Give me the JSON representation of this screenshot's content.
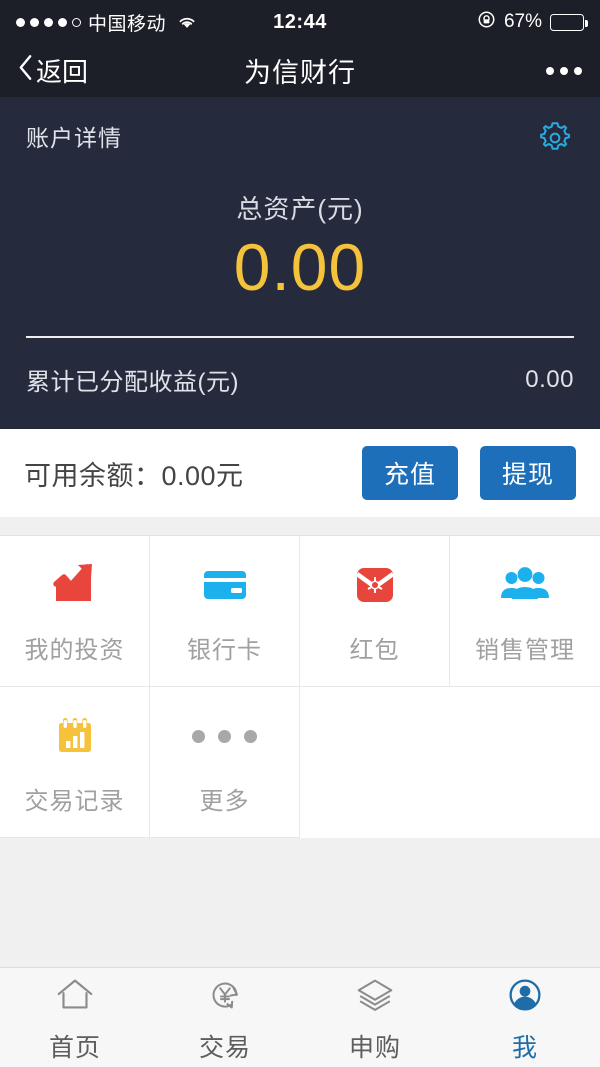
{
  "status_bar": {
    "signal_dots": 5,
    "signal_filled": 4,
    "carrier": "中国移动",
    "wifi_icon": "wifi-icon",
    "time": "12:44",
    "lock_icon": "rotation-lock-icon",
    "battery_percent": "67%",
    "battery_level": 67
  },
  "nav_bar": {
    "back_icon": "chevron-left-icon",
    "back_label": "返回",
    "title": "为信财行",
    "more_icon": "more-dots-icon"
  },
  "account": {
    "section_title": "账户详情",
    "settings_icon": "gear-icon",
    "total_label": "总资产(元)",
    "total_value": "0.00",
    "total_value_color": "#f5c33b",
    "income_label": "累计已分配收益(元)",
    "income_value": "0.00",
    "background_color": "#252b3c"
  },
  "balance": {
    "label": "可用余额：0.00元",
    "recharge_label": "充值",
    "withdraw_label": "提现",
    "button_color": "#1c6fb8"
  },
  "grid": {
    "items": [
      {
        "label": "我的投资",
        "icon": "chart-arrow-up-icon",
        "color": "#e8453c"
      },
      {
        "label": "银行卡",
        "icon": "bank-card-icon",
        "color": "#1cb0ec"
      },
      {
        "label": "红包",
        "icon": "red-envelope-icon",
        "color": "#e8453c"
      },
      {
        "label": "销售管理",
        "icon": "people-group-icon",
        "color": "#1cb0ec"
      },
      {
        "label": "交易记录",
        "icon": "calendar-chart-icon",
        "color": "#f5c33b"
      },
      {
        "label": "更多",
        "icon": "more-dots-icon",
        "color": "#a8a8a8"
      }
    ]
  },
  "tab_bar": {
    "tabs": [
      {
        "label": "首页",
        "icon": "home-icon",
        "active": false
      },
      {
        "label": "交易",
        "icon": "yen-refresh-icon",
        "active": false
      },
      {
        "label": "申购",
        "icon": "layers-icon",
        "active": false
      },
      {
        "label": "我",
        "icon": "user-circle-icon",
        "active": true
      }
    ],
    "active_color": "#1e6da8",
    "inactive_color": "#5d5d5d"
  }
}
